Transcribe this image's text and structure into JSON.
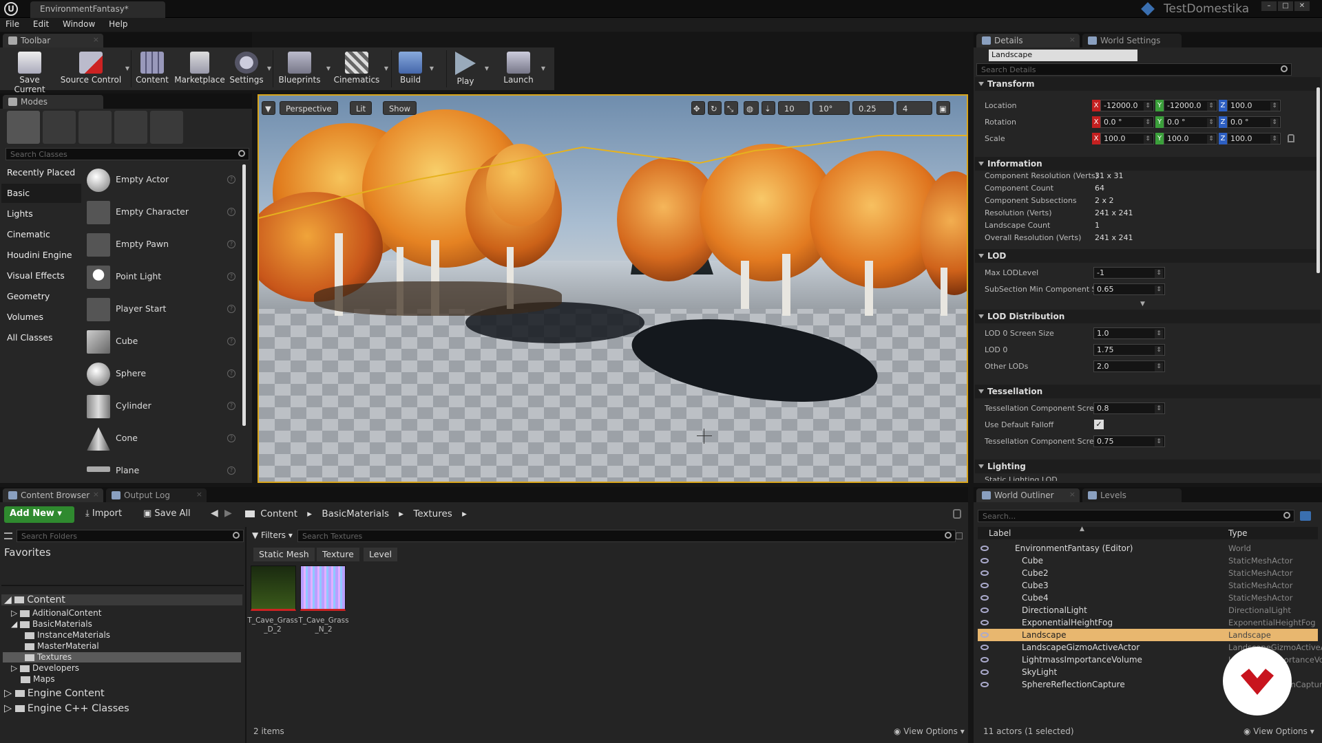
{
  "window": {
    "doc_tab": "EnvironmentFantasy*",
    "project": "TestDomestika"
  },
  "menu": [
    "File",
    "Edit",
    "Window",
    "Help"
  ],
  "toolbar": {
    "tab": "Toolbar",
    "buttons": [
      "Save Current",
      "Source Control",
      "Content",
      "Marketplace",
      "Settings",
      "Blueprints",
      "Cinematics",
      "Build",
      "Play",
      "Launch"
    ]
  },
  "modes": {
    "tab": "Modes",
    "search_placeholder": "Search Classes",
    "categories": [
      "Recently Placed",
      "Basic",
      "Lights",
      "Cinematic",
      "Houdini Engine",
      "Visual Effects",
      "Geometry",
      "Volumes",
      "All Classes"
    ],
    "actors": [
      "Empty Actor",
      "Empty Character",
      "Empty Pawn",
      "Point Light",
      "Player Start",
      "Cube",
      "Sphere",
      "Cylinder",
      "Cone",
      "Plane"
    ]
  },
  "viewport": {
    "perspective": "Perspective",
    "lit": "Lit",
    "show": "Show",
    "grid_snap": "10",
    "rot_snap": "10°",
    "scale_snap": "0.25",
    "cam_speed": "4"
  },
  "details": {
    "tab_details": "Details",
    "tab_world": "World Settings",
    "object_name": "Landscape",
    "search_placeholder": "Search Details",
    "transform": {
      "title": "Transform",
      "location_label": "Location",
      "rotation_label": "Rotation",
      "scale_label": "Scale",
      "location": [
        "-12000.0",
        "-12000.0",
        "100.0"
      ],
      "rotation": [
        "0.0 °",
        "0.0 °",
        "0.0 °"
      ],
      "scale": [
        "100.0",
        "100.0",
        "100.0"
      ]
    },
    "information": {
      "title": "Information",
      "rows": [
        {
          "label": "Component Resolution (Verts)",
          "value": "31 x 31"
        },
        {
          "label": "Component Count",
          "value": "64"
        },
        {
          "label": "Component Subsections",
          "value": "2 x 2"
        },
        {
          "label": "Resolution (Verts)",
          "value": "241 x 241"
        },
        {
          "label": "Landscape Count",
          "value": "1"
        },
        {
          "label": "Overall Resolution (Verts)",
          "value": "241 x 241"
        }
      ]
    },
    "lod": {
      "title": "LOD",
      "rows": [
        {
          "label": "Max LODLevel",
          "value": "-1"
        },
        {
          "label": "SubSection Min Component Sc",
          "value": "0.65"
        }
      ]
    },
    "lod_distribution": {
      "title": "LOD Distribution",
      "rows": [
        {
          "label": "LOD 0 Screen Size",
          "value": "1.0"
        },
        {
          "label": "LOD 0",
          "value": "1.75"
        },
        {
          "label": "Other LODs",
          "value": "2.0"
        }
      ]
    },
    "tessellation": {
      "title": "Tessellation",
      "rows": [
        {
          "label": "Tessellation Component Scree",
          "value": "0.8"
        },
        {
          "label": "Use Default Falloff",
          "value": ""
        },
        {
          "label": "Tessellation Component Scree",
          "value": "0.75"
        }
      ]
    },
    "lighting": {
      "title": "Lighting",
      "partial_label": "Static Lighting LOD"
    }
  },
  "content_browser": {
    "tab": "Content Browser",
    "tab2": "Output Log",
    "add_new": "Add New",
    "import": "Import",
    "save_all": "Save All",
    "path": [
      "Content",
      "BasicMaterials",
      "Textures"
    ],
    "search_folders": "Search Folders",
    "favorites": "Favorites",
    "filters": "Filters",
    "search_textures": "Search Textures",
    "chips": [
      "Static Mesh",
      "Texture",
      "Level"
    ],
    "tree": {
      "content": "Content",
      "aditional": "AditionalContent",
      "basic": "BasicMaterials",
      "instance": "InstanceMaterials",
      "master": "MasterMaterial",
      "textures": "Textures",
      "developers": "Developers",
      "maps": "Maps",
      "engine": "Engine Content",
      "cpp": "Engine C++ Classes"
    },
    "assets": [
      {
        "line1": "T_Cave_Grass",
        "line2": "_D_2"
      },
      {
        "line1": "T_Cave_Grass",
        "line2": "_N_2"
      }
    ],
    "count": "2 items",
    "view_options": "View Options"
  },
  "outliner": {
    "tab": "World Outliner",
    "tab2": "Levels",
    "search_placeholder": "Search...",
    "col_label": "Label",
    "col_type": "Type",
    "rows": [
      {
        "label": "EnvironmentFantasy (Editor)",
        "type": "World"
      },
      {
        "label": "Cube",
        "type": "StaticMeshActor"
      },
      {
        "label": "Cube2",
        "type": "StaticMeshActor"
      },
      {
        "label": "Cube3",
        "type": "StaticMeshActor"
      },
      {
        "label": "Cube4",
        "type": "StaticMeshActor"
      },
      {
        "label": "DirectionalLight",
        "type": "DirectionalLight"
      },
      {
        "label": "ExponentialHeightFog",
        "type": "ExponentialHeightFog"
      },
      {
        "label": "Landscape",
        "type": "Landscape"
      },
      {
        "label": "LandscapeGizmoActiveActor",
        "type": "LandscapeGizmoActiveA"
      },
      {
        "label": "LightmassImportanceVolume",
        "type": "LightmassImportanceVol"
      },
      {
        "label": "SkyLight",
        "type": "SkyLight"
      },
      {
        "label": "SphereReflectionCapture",
        "type": "SphereReflectionCapture"
      }
    ],
    "status": "11 actors (1 selected)",
    "view_options": "View Options"
  },
  "colors": {
    "accent": "#d9a51a",
    "selection": "#e8b76f",
    "brand": "#c8141e"
  }
}
